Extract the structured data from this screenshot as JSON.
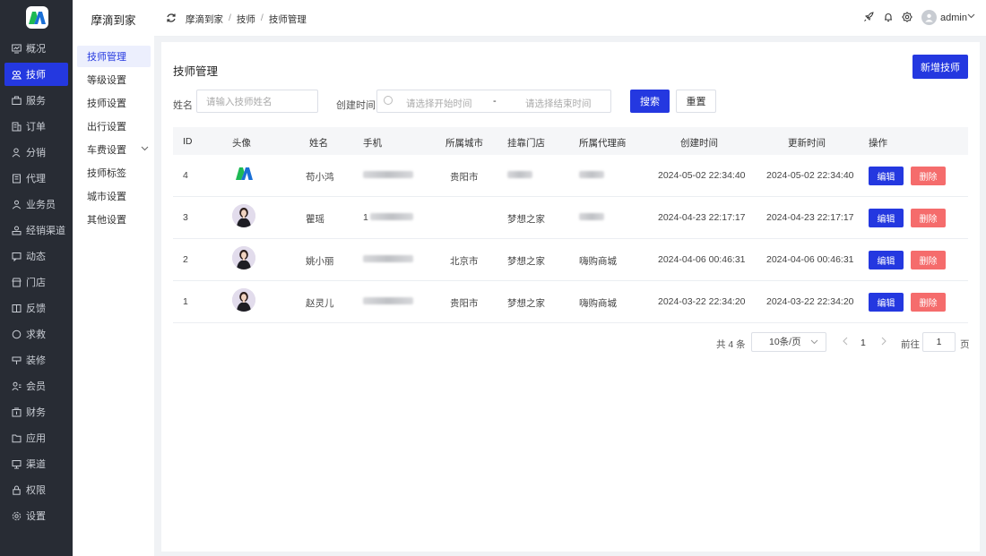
{
  "brand": {
    "name": "摩滴到家",
    "logo_letter": "M"
  },
  "rail": {
    "items": [
      {
        "label": "概况",
        "icon": "chart-monitor-icon"
      },
      {
        "label": "技师",
        "icon": "people-icon"
      },
      {
        "label": "服务",
        "icon": "briefcase-icon"
      },
      {
        "label": "订单",
        "icon": "order-icon"
      },
      {
        "label": "分销",
        "icon": "share-user-icon"
      },
      {
        "label": "代理",
        "icon": "building-icon"
      },
      {
        "label": "业务员",
        "icon": "user-group-icon"
      },
      {
        "label": "经销渠道",
        "icon": "channel-icon"
      },
      {
        "label": "动态",
        "icon": "message-icon"
      },
      {
        "label": "门店",
        "icon": "store-icon"
      },
      {
        "label": "反馈",
        "icon": "book-icon"
      },
      {
        "label": "求救",
        "icon": "circle-icon"
      },
      {
        "label": "装修",
        "icon": "brush-icon"
      },
      {
        "label": "会员",
        "icon": "member-icon"
      },
      {
        "label": "财务",
        "icon": "wallet-icon"
      },
      {
        "label": "应用",
        "icon": "folder-icon"
      },
      {
        "label": "渠道",
        "icon": "screen-icon"
      },
      {
        "label": "权限",
        "icon": "lock-icon"
      },
      {
        "label": "设置",
        "icon": "gear-icon"
      }
    ],
    "active_index": 1
  },
  "submenu": {
    "title": "摩滴到家",
    "items": [
      "技师管理",
      "等级设置",
      "技师设置",
      "出行设置",
      "车费设置",
      "技师标签",
      "城市设置",
      "其他设置"
    ],
    "active_index": 0
  },
  "topbar": {
    "breadcrumbs": [
      "摩滴到家",
      "技师",
      "技师管理"
    ],
    "separator": "/",
    "username": "admin"
  },
  "page": {
    "title": "技师管理",
    "add_button": "新增技师"
  },
  "filters": {
    "name_label": "姓名",
    "name_placeholder": "请输入技师姓名",
    "time_label": "创建时间",
    "start_placeholder": "请选择开始时间",
    "range_separator": "-",
    "end_placeholder": "请选择结束时间",
    "search_button": "搜索",
    "reset_button": "重置"
  },
  "table": {
    "columns": [
      "ID",
      "头像",
      "姓名",
      "手机",
      "所属城市",
      "挂靠门店",
      "所属代理商",
      "创建时间",
      "更新时间",
      "操作"
    ],
    "edit_label": "编辑",
    "delete_label": "删除",
    "rows": [
      {
        "id": "4",
        "avatar": "logo",
        "name": "苟小鸿",
        "phone": "",
        "city": "贵阳市",
        "store": "",
        "agent": "",
        "created": "2024-05-02 22:34:40",
        "updated": "2024-05-02 22:34:40"
      },
      {
        "id": "3",
        "avatar": "photo",
        "name": "瞿瑶",
        "phone": "1",
        "city": "",
        "store": "梦想之家",
        "agent": "",
        "created": "2024-04-23 22:17:17",
        "updated": "2024-04-23 22:17:17"
      },
      {
        "id": "2",
        "avatar": "photo",
        "name": "姚小丽",
        "phone": "",
        "city": "北京市",
        "store": "梦想之家",
        "agent": "嗨购商城",
        "created": "2024-04-06 00:46:31",
        "updated": "2024-04-06 00:46:31"
      },
      {
        "id": "1",
        "avatar": "photo",
        "name": "赵灵儿",
        "phone": "",
        "city": "贵阳市",
        "store": "梦想之家",
        "agent": "嗨购商城",
        "created": "2024-03-22 22:34:20",
        "updated": "2024-03-22 22:34:20"
      }
    ]
  },
  "pagination": {
    "total": "共 4 条",
    "page_size": "10条/页",
    "current_page": "1",
    "goto_label": "前往",
    "goto_value": "1",
    "page_unit": "页"
  },
  "colors": {
    "primary": "#2438e0",
    "danger": "#f56c6c",
    "rail_bg": "#282c34",
    "logo_green": "#1db954",
    "logo_blue": "#1a6fd6"
  }
}
